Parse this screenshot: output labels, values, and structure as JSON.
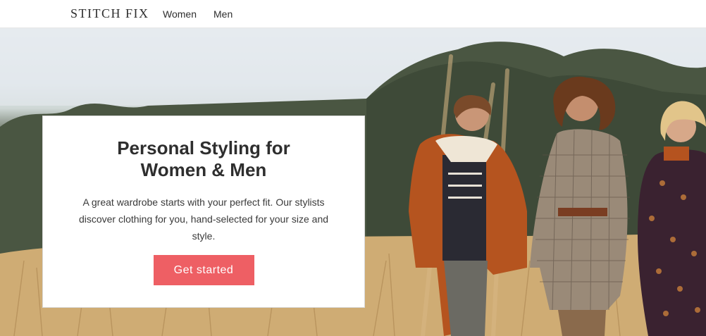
{
  "header": {
    "logo": "STITCH FIX",
    "nav": [
      {
        "label": "Women"
      },
      {
        "label": "Men"
      }
    ]
  },
  "hero": {
    "title": "Personal Styling for Women & Men",
    "description": "A great wardrobe starts with your perfect fit. Our stylists discover clothing for you, hand-selected for your size and style.",
    "cta_label": "Get started"
  },
  "colors": {
    "cta": "#ee5f64",
    "text": "#2e2e2e",
    "card_background": "#ffffff"
  }
}
